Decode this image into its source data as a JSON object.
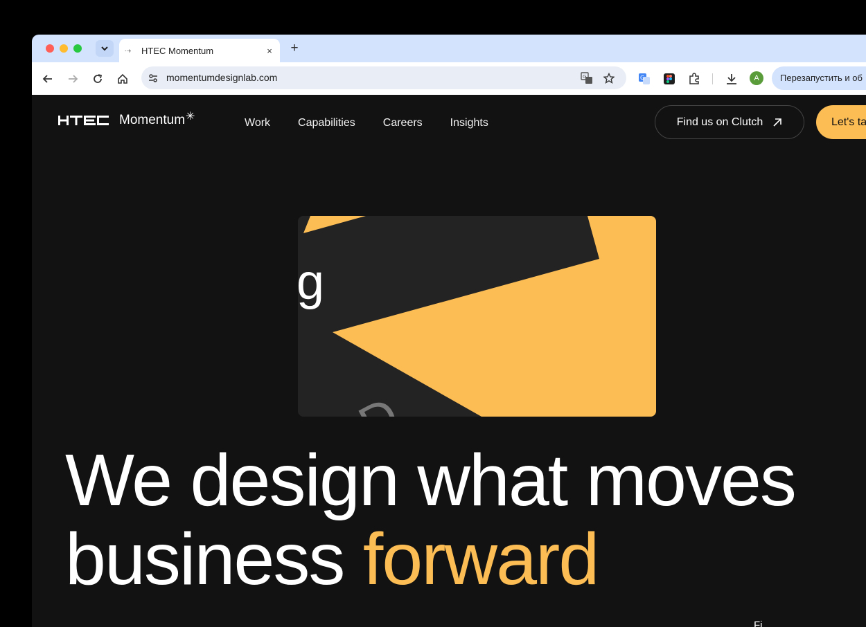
{
  "browser": {
    "tab": {
      "title": "HTEC Momentum",
      "close_glyph": "×"
    },
    "new_tab_glyph": "+",
    "url": "momentumdesignlab.com",
    "profile_initial": "A",
    "relaunch_label": "Перезапустить и об"
  },
  "site": {
    "logo": {
      "brand": "HTEC",
      "name": "Momentum",
      "star": "✳"
    },
    "nav": [
      {
        "label": "Work"
      },
      {
        "label": "Capabilities"
      },
      {
        "label": "Careers"
      },
      {
        "label": "Insights"
      }
    ],
    "clutch_label": "Find us on Clutch",
    "cta_label": "Let's ta",
    "hero_card": {
      "letter_top": "g",
      "letter_bottom": "D"
    },
    "headline": {
      "line1": "We design what moves",
      "line2_plain": "business ",
      "line2_accent": "forward"
    },
    "bottom_hint": "Fi..."
  },
  "colors": {
    "accent": "#fcbd55",
    "page_bg": "#121212",
    "tabstrip": "#d3e3fd"
  },
  "icons": [
    "chevron-down-icon",
    "back-icon",
    "forward-icon",
    "reload-icon",
    "home-icon",
    "tune-icon",
    "translate-icon",
    "star-icon",
    "google-translate-icon",
    "figma-icon",
    "extensions-icon",
    "download-icon",
    "arrow-up-right-icon"
  ]
}
